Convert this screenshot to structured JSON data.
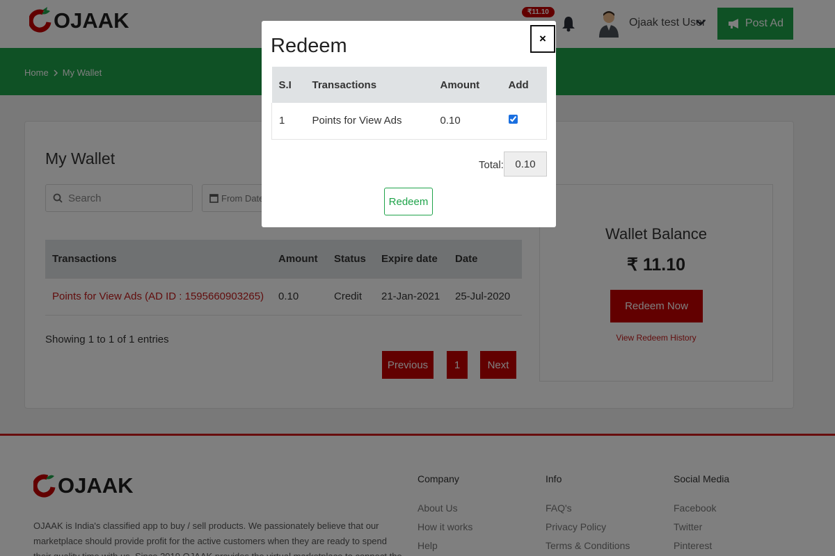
{
  "header": {
    "brand": "OJAAK",
    "wallet_pill": "₹11.10",
    "user_name": "Ojaak test User",
    "post_ad_label": "Post Ad"
  },
  "breadcrumb": {
    "home": "Home",
    "current": "My Wallet"
  },
  "wallet": {
    "title": "My Wallet",
    "search_placeholder": "Search",
    "from_date_placeholder": "From Date",
    "table": {
      "headers": [
        "Transactions",
        "Amount",
        "Status",
        "Expire date",
        "Date"
      ],
      "rows": [
        [
          "Points for View Ads (AD ID : 1595660903265)",
          "0.10",
          "Credit",
          "21-Jan-2021",
          "25-Jul-2020"
        ]
      ]
    },
    "entries_text": "Showing 1 to 1 of 1 entries",
    "pagination": {
      "previous": "Previous",
      "page": "1",
      "next": "Next"
    }
  },
  "balance": {
    "title": "Wallet Balance",
    "amount": "₹ 11.10",
    "redeem_now": "Redeem Now",
    "history_link": "View Redeem History"
  },
  "footer": {
    "brand": "OJAAK",
    "about": "OJAAK is India's classified app to buy / sell products. We passionately believe that our marketplace should provide profit for the active customers when they are ready to spend their quality time with us. Since 2019 OJAAK provides the virtual marketplace to connect the trusted buyers and sellers.",
    "columns": [
      {
        "heading": "Company",
        "links": [
          "About Us",
          "How it works",
          "Help"
        ]
      },
      {
        "heading": "Info",
        "links": [
          "FAQ's",
          "Privacy Policy",
          "Terms & Conditions"
        ]
      },
      {
        "heading": "Social Media",
        "links": [
          "Facebook",
          "Twitter",
          "Pinterest"
        ]
      }
    ]
  },
  "modal": {
    "title": "Redeem",
    "close": "×",
    "headers": [
      "S.I",
      "Transactions",
      "Amount",
      "Add"
    ],
    "rows": [
      {
        "si": "1",
        "transaction": "Points for View Ads",
        "amount": "0.10",
        "checked": true
      }
    ],
    "total_label": "Total:",
    "total_value": "0.10",
    "redeem_button": "Redeem"
  },
  "colors": {
    "green": "#1fa34a",
    "red": "#c40000",
    "link_red": "#c31a1a"
  }
}
